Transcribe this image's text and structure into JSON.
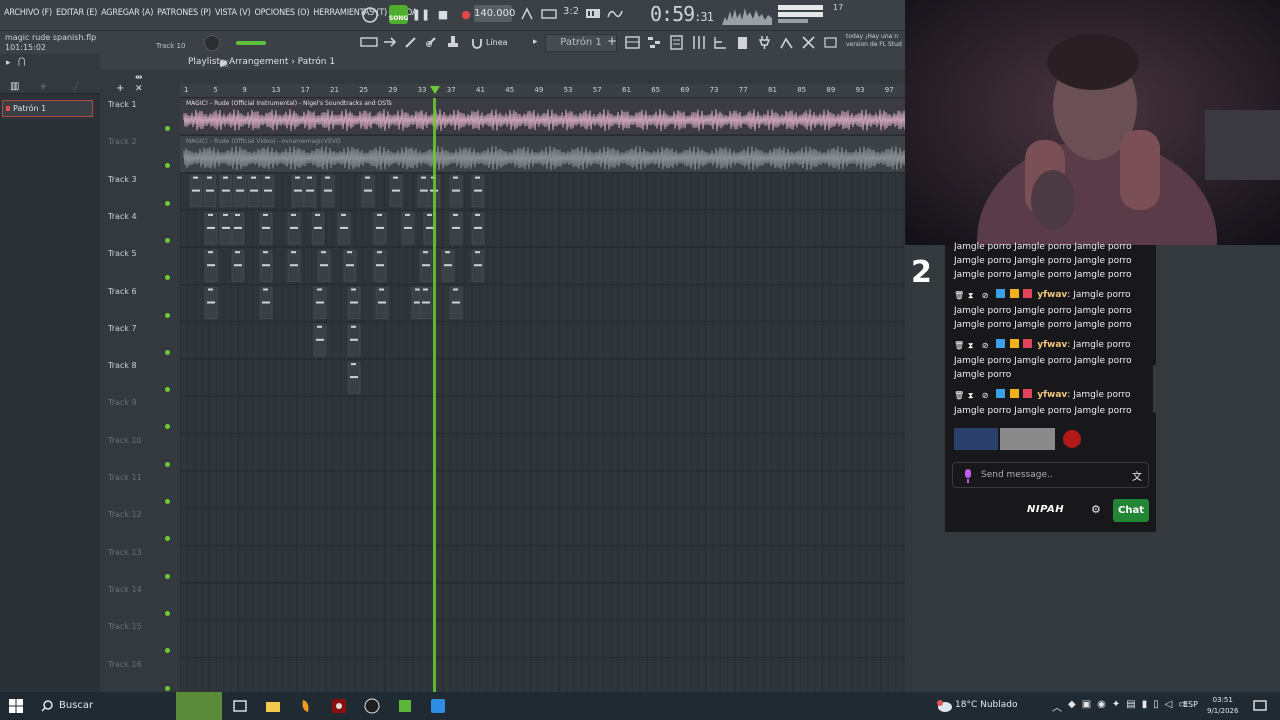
{
  "menu": {
    "items": [
      "ARCHIVO (F)",
      "EDITAR (E)",
      "AGREGAR (A)",
      "PATRONES (P)",
      "VISTA (V)",
      "OPCIONES (O)",
      "HERRAMIENTAS (T)",
      "AYUDA"
    ]
  },
  "transport": {
    "song_badge": "SONG",
    "bpm": "140.000",
    "time_main": "0:59",
    "time_sub": ":31",
    "mem_top": "1",
    "poly": "17"
  },
  "project": {
    "name": "magic rude spanish.flp",
    "time": "101:15:02",
    "hint_track": "Track 10"
  },
  "toolbar": {
    "snap": "Línea",
    "pattern": "Patrón 1",
    "hint_lines": [
      "today ¡Hay una n",
      "version de FL Stud"
    ]
  },
  "browser": {
    "pattern_item": "Patrón 1"
  },
  "playlist": {
    "title": "Playlist - Arrangement › Patrón 1",
    "ruler": [
      "1",
      "5",
      "9",
      "13",
      "17",
      "21",
      "25",
      "29",
      "33",
      "37",
      "41",
      "45",
      "49",
      "53",
      "57",
      "61",
      "65",
      "69",
      "73",
      "77",
      "81",
      "85",
      "89",
      "93",
      "97"
    ],
    "clip1": "MAGIC! - Rude (Official Instrumental) - Nigel's Soundtracks and OSTs",
    "clip2": "MAGIC! - Rude (Official Video) - ovnamemagicVEVO",
    "tracks": [
      "Track 1",
      "Track 2",
      "Track 3",
      "Track 4",
      "Track 5",
      "Track 6",
      "Track 7",
      "Track 8",
      "Track 9",
      "Track 10",
      "Track 11",
      "Track 12",
      "Track 13",
      "Track 14",
      "Track 15",
      "Track 16"
    ]
  },
  "chat": {
    "counter": "2",
    "top_partial": "Jamgle porro Jamgle porro Jamgle porro",
    "top_l1": "Jamgle porro Jamgle porro Jamgle porro",
    "top_l2": "Jamgle porro Jamgle porro Jamgle porro",
    "messages": [
      {
        "user": "yfwav",
        "lines": [
          "Jamgle porro",
          "Jamgle porro Jamgle porro Jamgle porro",
          "Jamgle porro Jamgle porro Jamgle porro"
        ]
      },
      {
        "user": "yfwav",
        "lines": [
          "Jamgle porro",
          "Jamgle porro Jamgle porro Jamgle porro",
          "Jamgle porro"
        ]
      },
      {
        "user": "yfwav",
        "lines": [
          "Jamgle porro",
          "Jamgle porro Jamgle porro Jamgle porro"
        ]
      }
    ],
    "placeholder": "Send message..",
    "brand": "NIPAH",
    "send_label": "Chat"
  },
  "taskbar": {
    "search": "Buscar",
    "weather": "18°C  Nublado",
    "lang": "ESP",
    "time": "03:51",
    "date": "9/1/2026"
  },
  "colors": {
    "playhead": "#6ccb34",
    "audio_clip1": "#c9a3b6",
    "audio_clip2": "#8b9095",
    "chat_bg": "#18181b",
    "chat_send": "#238636"
  }
}
